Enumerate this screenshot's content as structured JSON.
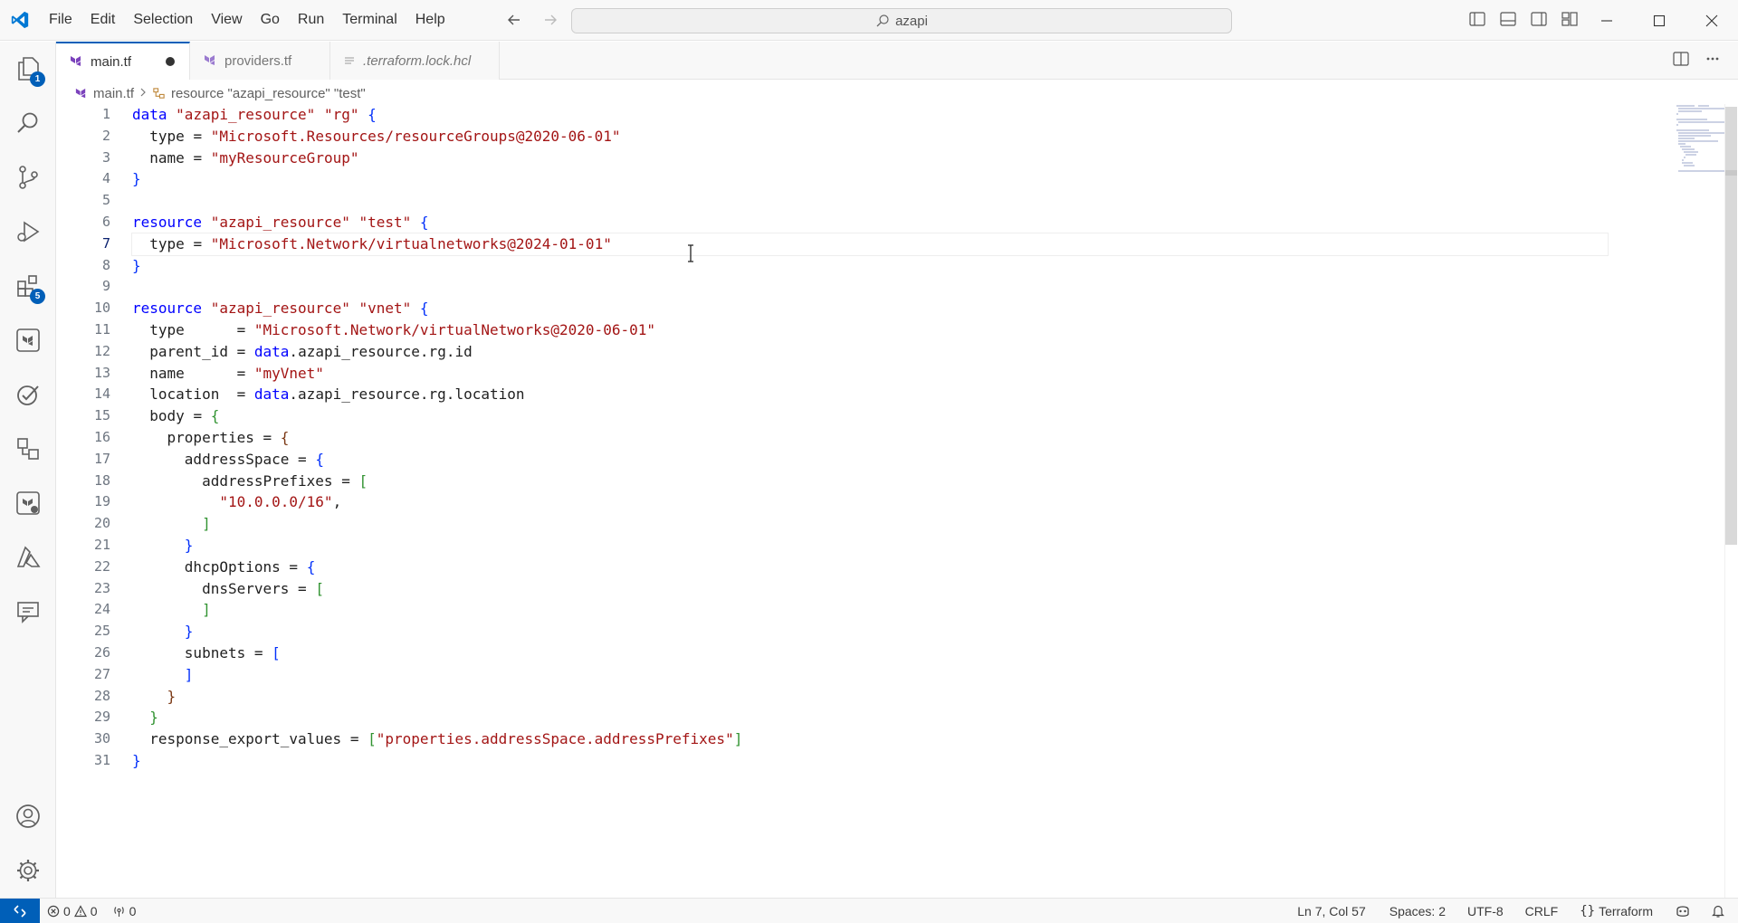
{
  "menu": [
    "File",
    "Edit",
    "Selection",
    "View",
    "Go",
    "Run",
    "Terminal",
    "Help"
  ],
  "search": {
    "text": "azapi"
  },
  "activity_badges": {
    "explorer": "1",
    "extensions": "5"
  },
  "tabs": [
    {
      "label": "main.tf",
      "active": true,
      "dirty": true
    },
    {
      "label": "providers.tf",
      "active": false,
      "dirty": false
    },
    {
      "label": ".terraform.lock.hcl",
      "active": false,
      "dirty": false
    }
  ],
  "breadcrumb": {
    "file": "main.tf",
    "symbol": "resource \"azapi_resource\" \"test\""
  },
  "editor": {
    "current_line": 7,
    "line_numbers": [
      "1",
      "2",
      "3",
      "4",
      "5",
      "6",
      "7",
      "8",
      "9",
      "10",
      "11",
      "12",
      "13",
      "14",
      "15",
      "16",
      "17",
      "18",
      "19",
      "20",
      "21",
      "22",
      "23",
      "24",
      "25",
      "26",
      "27",
      "28",
      "29",
      "30",
      "31"
    ],
    "lines": [
      "data \"azapi_resource\" \"rg\" {",
      "  type = \"Microsoft.Resources/resourceGroups@2020-06-01\"",
      "  name = \"myResourceGroup\"",
      "}",
      "",
      "resource \"azapi_resource\" \"test\" {",
      "  type = \"Microsoft.Network/virtualnetworks@2024-01-01\"",
      "}",
      "",
      "resource \"azapi_resource\" \"vnet\" {",
      "  type      = \"Microsoft.Network/virtualNetworks@2020-06-01\"",
      "  parent_id = data.azapi_resource.rg.id",
      "  name      = \"myVnet\"",
      "  location  = data.azapi_resource.rg.location",
      "  body = {",
      "    properties = {",
      "      addressSpace = {",
      "        addressPrefixes = [",
      "          \"10.0.0.0/16\",",
      "        ]",
      "      }",
      "      dhcpOptions = {",
      "        dnsServers = [",
      "        ]",
      "      }",
      "      subnets = [",
      "      ]",
      "    }",
      "  }",
      "  response_export_values = [\"properties.addressSpace.addressPrefixes\"]",
      "}"
    ]
  },
  "status": {
    "errors": "0",
    "warnings": "0",
    "ports": "0",
    "position": "Ln 7, Col 57",
    "spaces": "Spaces: 2",
    "encoding": "UTF-8",
    "eol": "CRLF",
    "language": "Terraform"
  },
  "colors": {
    "accent": "#005fb8",
    "keyword": "#0000ff",
    "string": "#a31515",
    "identifier": "#001080"
  }
}
